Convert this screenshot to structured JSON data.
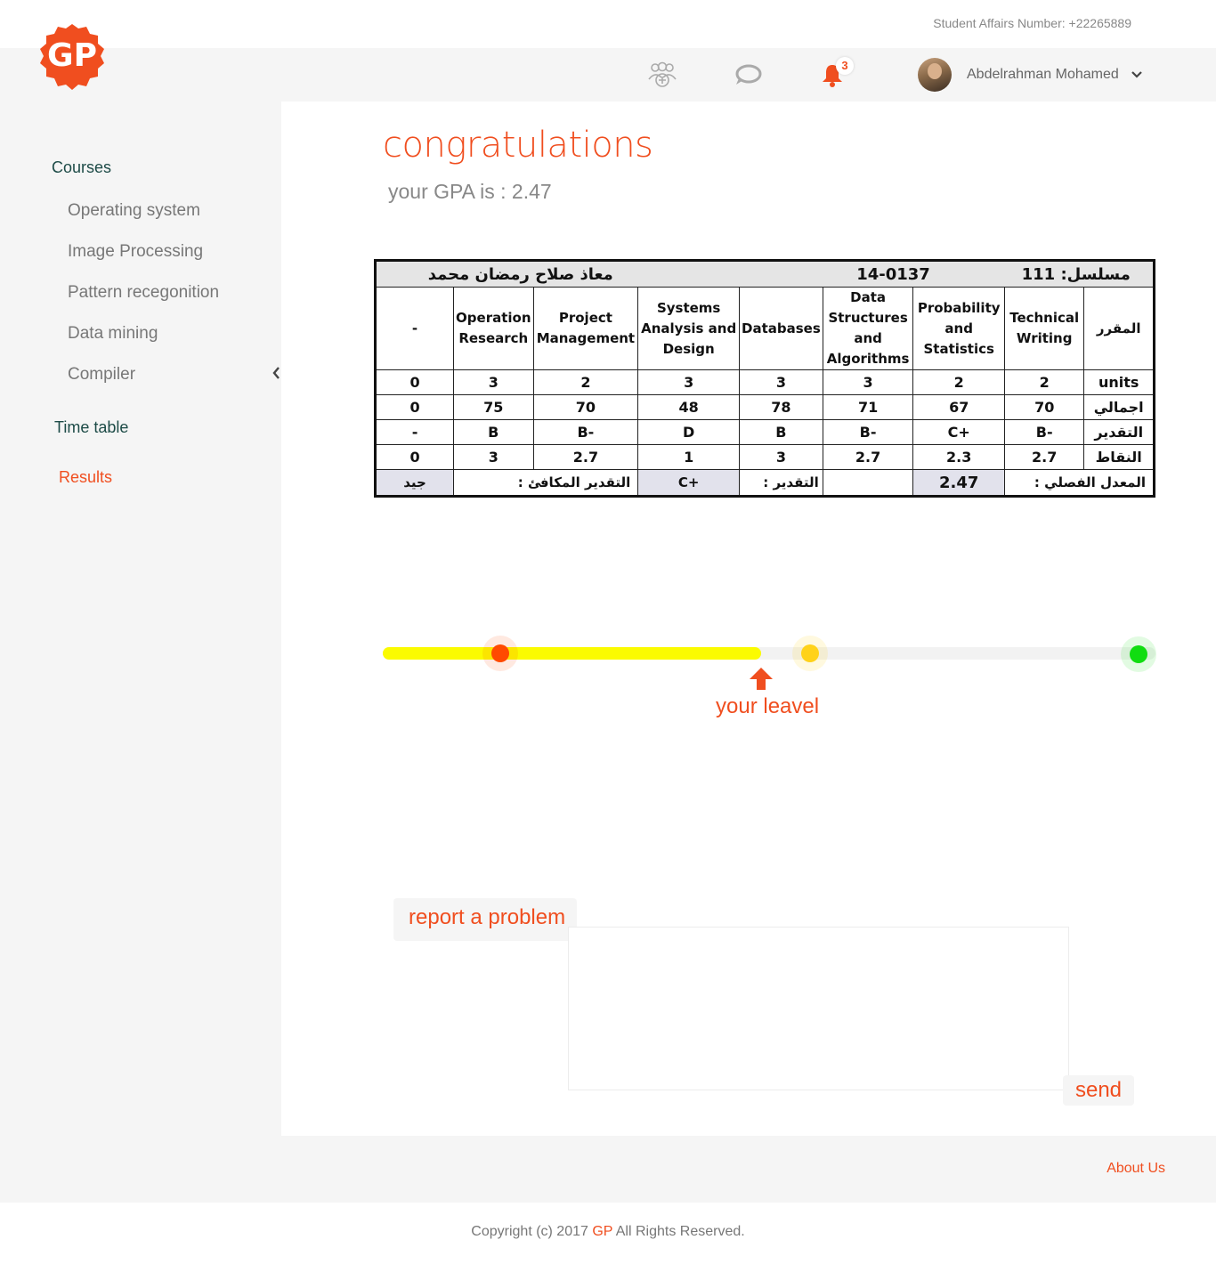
{
  "header": {
    "logo_text": "GP",
    "student_affairs": "Student Affairs Number: +22265889",
    "notification_count": "3",
    "user_name": "Abdelrahman Mohamed",
    "icons": [
      "group-add-icon",
      "chat-icon",
      "bell-icon",
      "chevron-down-icon"
    ]
  },
  "sidebar": {
    "courses_heading": "Courses",
    "courses": [
      {
        "label": "Operating system"
      },
      {
        "label": "Image Processing"
      },
      {
        "label": "Pattern recegonition"
      },
      {
        "label": "Data mining"
      },
      {
        "label": "Compiler"
      }
    ],
    "timetable_label": "Time table",
    "results_label": "Results"
  },
  "main": {
    "title": "congratulations",
    "gpa_text": "your GPA is : 2.47",
    "level_label": "your leavel",
    "level_progress": 0.49,
    "report_label": "report a problem",
    "report_value": "",
    "send_label": "send"
  },
  "grade_table": {
    "student_name": "معاذ صلاح رمضان محمد",
    "student_id": "14-0137",
    "serial": "مسلسل: 111",
    "courses": [
      "-",
      "Operation Research",
      "Project Management",
      "Systems Analysis and Design",
      "Databases",
      "Data Structures and Algorithms",
      "Probability and Statistics",
      "Technical Writing"
    ],
    "course_header_label": "المقرر",
    "rows": [
      {
        "label": "units",
        "values": [
          "0",
          "3",
          "2",
          "3",
          "3",
          "3",
          "2",
          "2"
        ]
      },
      {
        "label": "اجمالي",
        "values": [
          "0",
          "75",
          "70",
          "48",
          "78",
          "71",
          "67",
          "70"
        ]
      },
      {
        "label": "التقدير",
        "values": [
          "-",
          "B",
          "B-",
          "D",
          "B",
          "B-",
          "C+",
          "B-"
        ]
      },
      {
        "label": "النقاط",
        "values": [
          "0",
          "3",
          "2.7",
          "1",
          "3",
          "2.7",
          "2.3",
          "2.7"
        ]
      }
    ],
    "footer": {
      "equivalent_grade_value": "جيد",
      "equivalent_grade_label": "التقدير المكافئ :",
      "grade_value": "C+",
      "grade_label": "التقدير :",
      "semester_gpa_value": "2.47",
      "semester_gpa_label": "المعدل الفصلي :"
    }
  },
  "footer": {
    "about_label": "About Us",
    "copyright_prefix": "Copyright (c) 2017",
    "copyright_brand": "GP",
    "copyright_suffix": "All Rights Reserved."
  },
  "colors": {
    "accent": "#f04e1f",
    "sidebar_heading": "#1d4b47",
    "progress_fill": "#fbfb00",
    "level_low": "#ff4a00",
    "level_mid": "#ffd21a",
    "level_high": "#11dd11"
  }
}
